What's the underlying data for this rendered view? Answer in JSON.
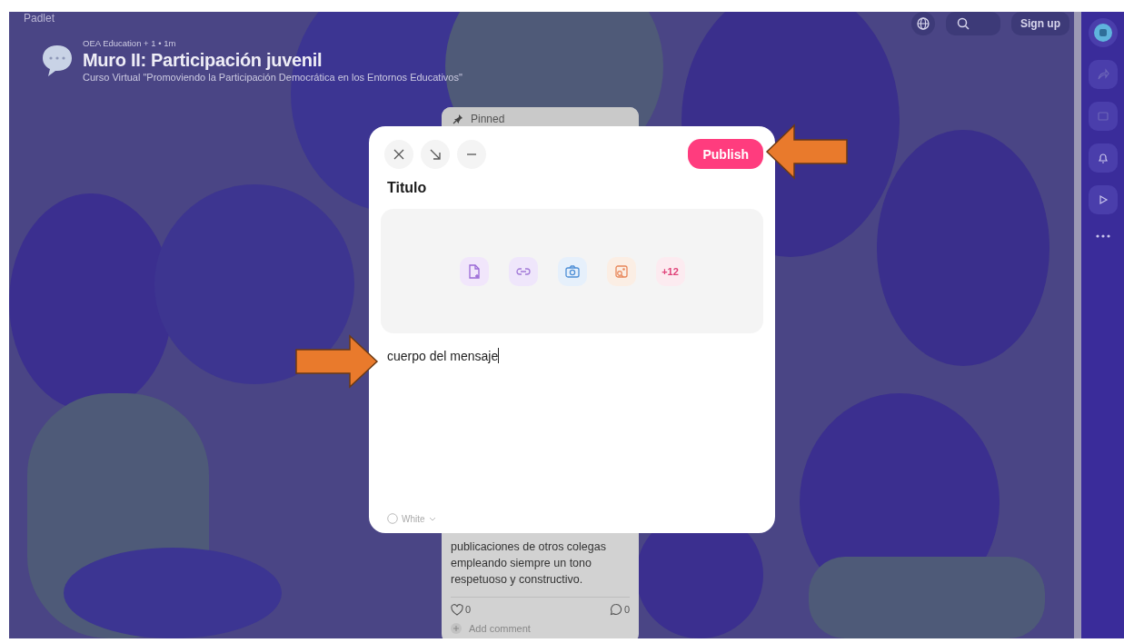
{
  "app": {
    "name": "Padlet"
  },
  "board": {
    "meta": "OEA Education + 1 • 1m",
    "title": "Muro II: Participación juvenil",
    "subtitle": "Curso Virtual \"Promoviendo la Participación Democrática en los Entornos Educativos\""
  },
  "top_bar": {
    "sign_up": "Sign up"
  },
  "side_rail": {
    "items": [
      {
        "kind": "avatar"
      },
      {
        "kind": "share"
      },
      {
        "kind": "slideshow"
      },
      {
        "kind": "bell"
      },
      {
        "kind": "play"
      },
      {
        "kind": "more"
      }
    ]
  },
  "post": {
    "pinned": "Pinned",
    "body": "publicaciones de otros colegas empleando siempre un tono respetuoso y constructivo.",
    "likes": "0",
    "comments": "0",
    "add_comment": "Add comment"
  },
  "composer": {
    "title": "Titulo",
    "body": "cuerpo del mensaje",
    "publish": "Publish",
    "color_label": "White",
    "attachments": [
      {
        "kind": "file"
      },
      {
        "kind": "link"
      },
      {
        "kind": "camera"
      },
      {
        "kind": "image"
      },
      {
        "kind": "more",
        "label": "+12"
      }
    ]
  }
}
